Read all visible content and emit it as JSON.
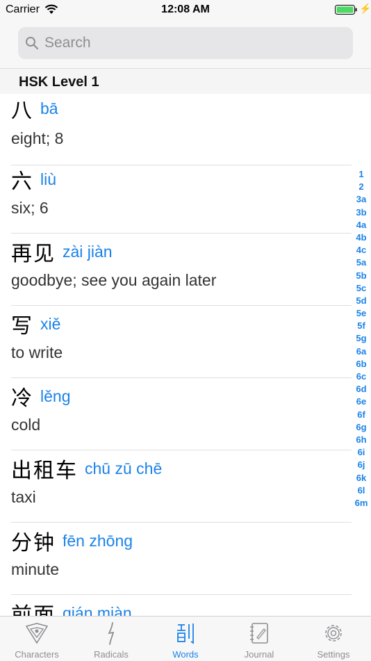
{
  "status_bar": {
    "carrier": "Carrier",
    "time": "12:08 AM"
  },
  "search": {
    "placeholder": "Search"
  },
  "section": {
    "title": "HSK Level 1"
  },
  "words": [
    {
      "hanzi": "八",
      "pinyin": "bā",
      "meaning": "eight; 8"
    },
    {
      "hanzi": "六",
      "pinyin": "liù",
      "meaning": "six; 6"
    },
    {
      "hanzi": "再见",
      "pinyin": "zài jiàn",
      "meaning": "goodbye; see you again later"
    },
    {
      "hanzi": "写",
      "pinyin": "xiě",
      "meaning": "to write"
    },
    {
      "hanzi": "冷",
      "pinyin": "lěng",
      "meaning": "cold"
    },
    {
      "hanzi": "出租车",
      "pinyin": "chū zū chē",
      "meaning": "taxi"
    },
    {
      "hanzi": "分钟",
      "pinyin": "fēn zhōng",
      "meaning": "minute"
    },
    {
      "hanzi": "前面",
      "pinyin": "qián miàn",
      "meaning": ""
    }
  ],
  "index": [
    "1",
    "2",
    "3a",
    "3b",
    "4a",
    "4b",
    "4c",
    "5a",
    "5b",
    "5c",
    "5d",
    "5e",
    "5f",
    "5g",
    "6a",
    "6b",
    "6c",
    "6d",
    "6e",
    "6f",
    "6g",
    "6h",
    "6i",
    "6j",
    "6k",
    "6l",
    "6m"
  ],
  "tabs": [
    {
      "label": "Characters",
      "icon": "characters-icon",
      "active": false
    },
    {
      "label": "Radicals",
      "icon": "radicals-icon",
      "active": false
    },
    {
      "label": "Words",
      "icon": "words-icon",
      "active": true
    },
    {
      "label": "Journal",
      "icon": "journal-icon",
      "active": false
    },
    {
      "label": "Settings",
      "icon": "settings-icon",
      "active": false
    }
  ],
  "colors": {
    "accent": "#1a82e8",
    "battery": "#4cd964",
    "inactive": "#8e8e93"
  }
}
